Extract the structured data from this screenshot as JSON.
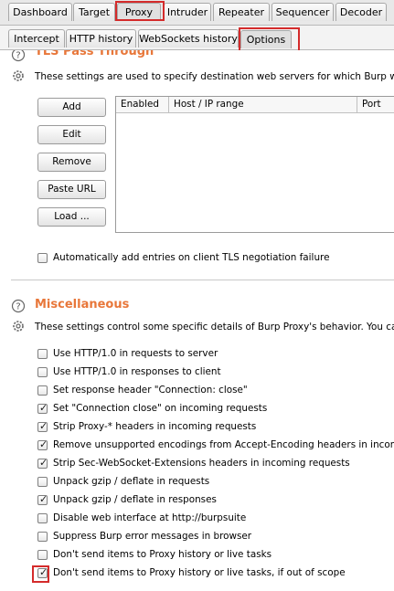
{
  "main_tabs": [
    {
      "label": "Dashboard",
      "selected": false
    },
    {
      "label": "Target",
      "selected": false
    },
    {
      "label": "Proxy",
      "selected": true
    },
    {
      "label": "Intruder",
      "selected": false
    },
    {
      "label": "Repeater",
      "selected": false
    },
    {
      "label": "Sequencer",
      "selected": false
    },
    {
      "label": "Decoder",
      "selected": false
    }
  ],
  "sub_tabs": [
    {
      "label": "Intercept",
      "selected": false
    },
    {
      "label": "HTTP history",
      "selected": false
    },
    {
      "label": "WebSockets history",
      "selected": false
    },
    {
      "label": "Options",
      "selected": true
    }
  ],
  "tls_pass_through": {
    "title": "TLS Pass Through",
    "description": "These settings are used to specify destination web servers for which Burp will dire",
    "buttons": [
      "Add",
      "Edit",
      "Remove",
      "Paste URL",
      "Load ..."
    ],
    "columns": [
      "Enabled",
      "Host / IP range",
      "Port"
    ],
    "auto_add": {
      "label": "Automatically add entries on client TLS negotiation failure",
      "checked": false
    }
  },
  "miscellaneous": {
    "title": "Miscellaneous",
    "description": "These settings control some specific details of Burp Proxy's behavior. You can cha",
    "options": [
      {
        "label": "Use HTTP/1.0 in requests to server",
        "checked": false
      },
      {
        "label": "Use HTTP/1.0 in responses to client",
        "checked": false
      },
      {
        "label": "Set response header \"Connection: close\"",
        "checked": false
      },
      {
        "label": "Set \"Connection close\" on incoming requests",
        "checked": true
      },
      {
        "label": "Strip Proxy-* headers in incoming requests",
        "checked": true
      },
      {
        "label": "Remove unsupported encodings from Accept-Encoding headers in incoming r",
        "checked": true
      },
      {
        "label": "Strip Sec-WebSocket-Extensions headers in incoming requests",
        "checked": true
      },
      {
        "label": "Unpack gzip / deflate in requests",
        "checked": false
      },
      {
        "label": "Unpack gzip / deflate in responses",
        "checked": true
      },
      {
        "label": "Disable web interface at http://burpsuite",
        "checked": false
      },
      {
        "label": "Suppress Burp error messages in browser",
        "checked": false
      },
      {
        "label": "Don't send items to Proxy history or live tasks",
        "checked": false
      },
      {
        "label": "Don't send items to Proxy history or live tasks, if out of scope",
        "checked": true
      }
    ]
  },
  "colors": {
    "section_title": "#e8773a",
    "highlight": "#d42b2b"
  },
  "icons": {
    "help": "help-icon",
    "settings": "gear-icon",
    "check": "check-icon"
  }
}
